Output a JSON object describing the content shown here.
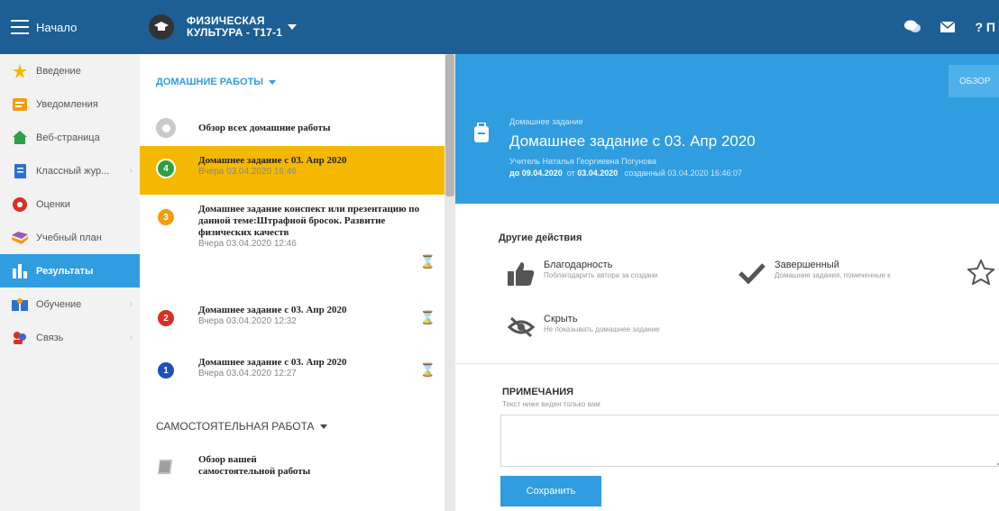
{
  "topbar": {
    "home_label": "Начало",
    "course_line1": "ФИЗИЧЕСКАЯ",
    "course_line2": "КУЛЬТУРА - Т17-1",
    "help_label": "? П"
  },
  "sidebar": {
    "items": [
      {
        "label": "Введение",
        "icon": "star-icon"
      },
      {
        "label": "Уведомления",
        "icon": "notifications-icon"
      },
      {
        "label": "Веб-страница",
        "icon": "webpage-icon"
      },
      {
        "label": "Класcный жур...",
        "icon": "journal-icon"
      },
      {
        "label": "Оценки",
        "icon": "grades-icon"
      },
      {
        "label": "Учебный план",
        "icon": "plan-icon"
      },
      {
        "label": "Результаты",
        "icon": "results-icon"
      },
      {
        "label": "Обучение",
        "icon": "learning-icon"
      },
      {
        "label": "Связь",
        "icon": "contacts-icon"
      }
    ]
  },
  "list": {
    "homework_header": "ДОМАШНИЕ РАБОТЫ",
    "overview_label": "Обзор всех домашние работы",
    "items": [
      {
        "badge": "4",
        "title": "Домашнее задание с 03. Апр 2020",
        "date": "Вчера 03.04.2020 16:46",
        "color": "#2ea043"
      },
      {
        "badge": "3",
        "title": "Домашнее задание конспект или презентацию по данной теме:Штрафной бросок. Развитие физических качеств",
        "date": "Вчера 03.04.2020 12:46",
        "color": "#f39c12"
      },
      {
        "badge": "2",
        "title": "Домашнее задание с 03. Апр 2020",
        "date": "Вчера 03.04.2020 12:32",
        "color": "#d93025"
      },
      {
        "badge": "1",
        "title": "Домашнее задание с 03. Апр 2020",
        "date": "Вчера 03.04.2020 12:27",
        "color": "#1e4fbf"
      }
    ],
    "self_work_header": "САМОСТОЯТЕЛЬНАЯ РАБОТА",
    "self_work_line1": "Обзор вашей",
    "self_work_line2": "самостоятельной работы"
  },
  "detail": {
    "tab_label": "ОБЗОР",
    "kicker": "Домашнее задание",
    "title": "Домашнее задание с 03. Апр 2020",
    "teacher": "Учитель Наталья Георгиевна Погунова",
    "due": "до 09.04.2020",
    "from_prefix": "от",
    "from_date": "03.04.2020",
    "created": "созданный 03.04.2020 16:46:07",
    "actions_title": "Другие действия",
    "actions": [
      {
        "label": "Благодарность",
        "sub": "Поблагодарить автора за создани"
      },
      {
        "label": "Завершенный",
        "sub": "Домашние задания, помеченные к"
      },
      {
        "label": "Скрыть",
        "sub": "Не показывать домашнее задание"
      }
    ],
    "notes_title": "ПРИМЕЧАНИЯ",
    "notes_sub": "Текст ниже виден только вам",
    "save_label": "Сохранить"
  },
  "colors": {
    "topbar": "#1d5f94",
    "accent": "#2f9de0",
    "selected": "#f5b800"
  }
}
